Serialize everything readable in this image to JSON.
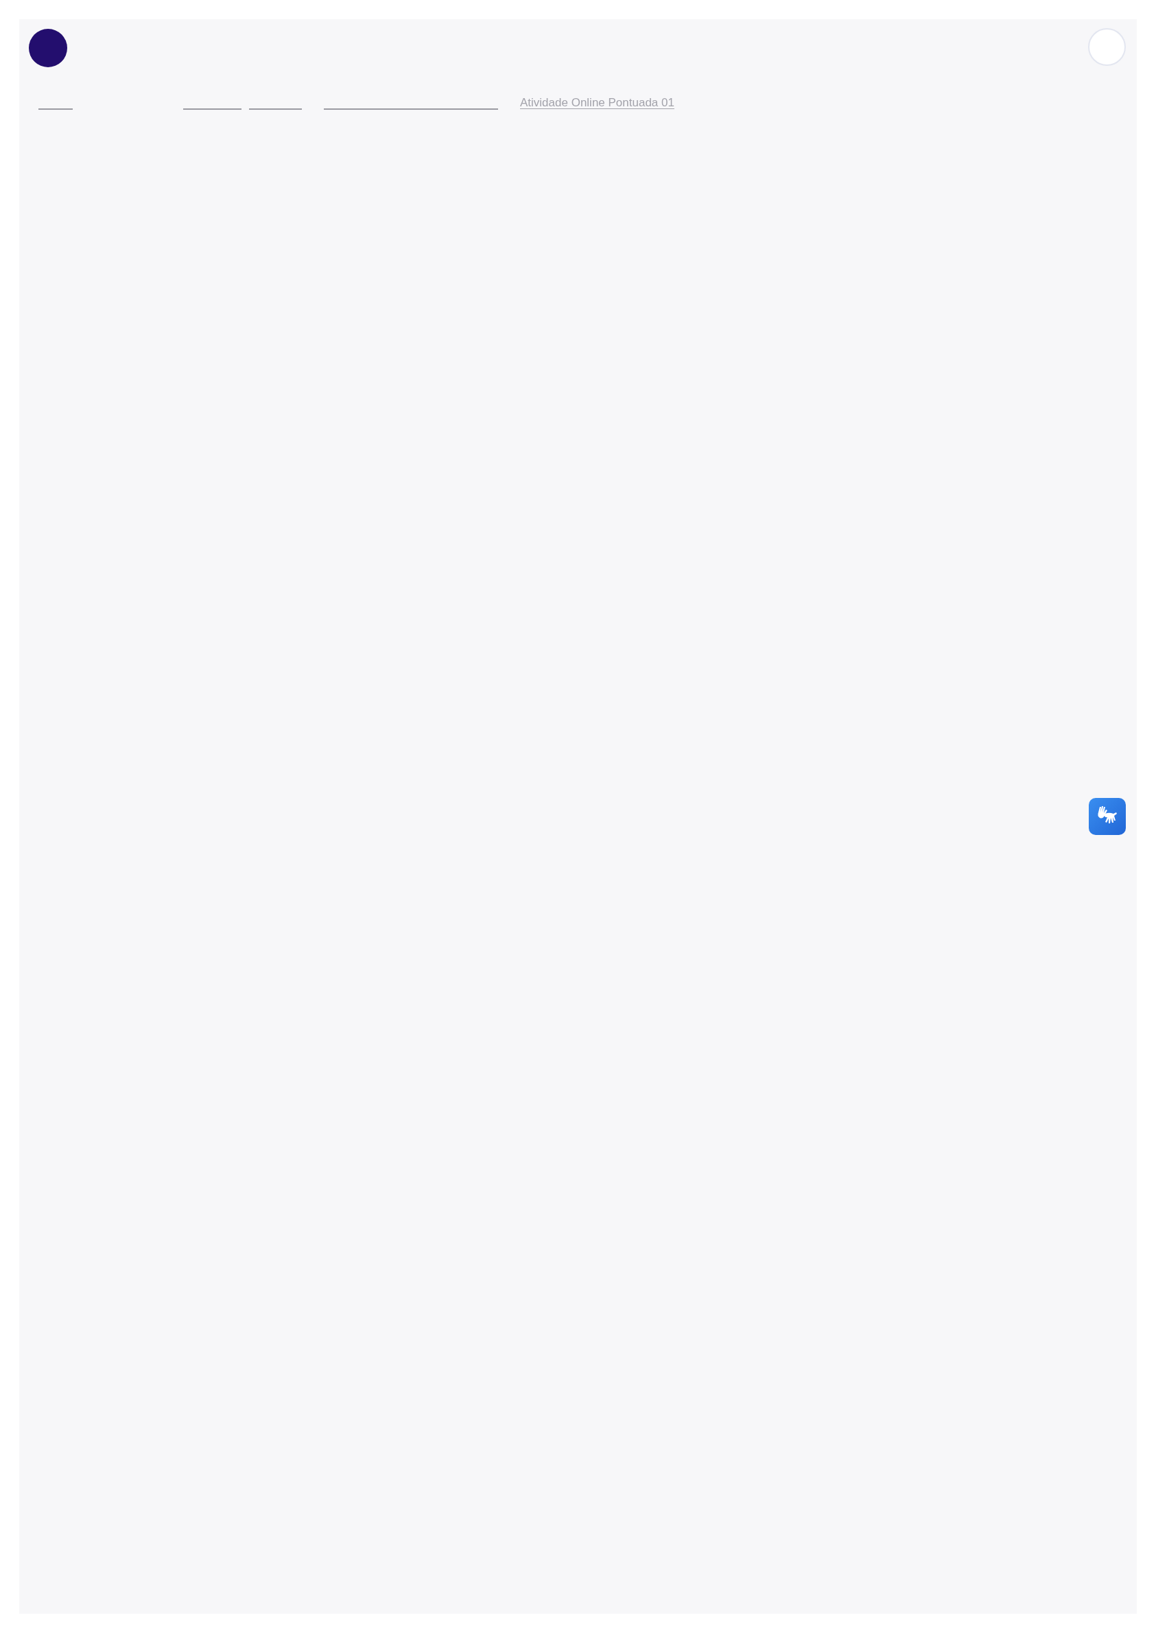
{
  "breadcrumb": {
    "current": "Atividade Online Pontuada 01"
  }
}
